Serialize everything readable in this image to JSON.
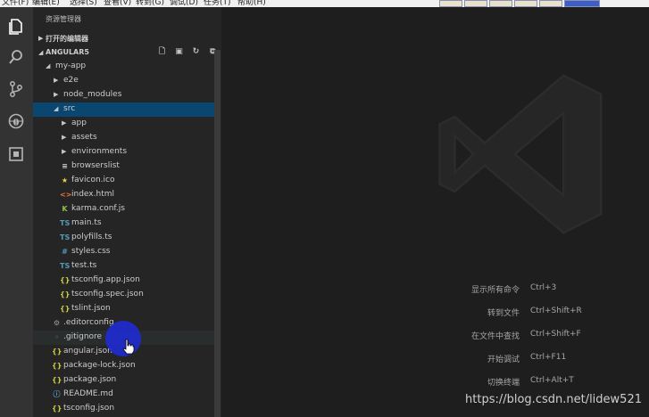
{
  "menu": {
    "items": [
      "文件(F)",
      "编辑(E)",
      "选择(S)",
      "查看(V)",
      "转到(G)",
      "调试(D)",
      "任务(T)",
      "帮助(H)"
    ]
  },
  "activity": {
    "icons": [
      "files-icon",
      "search-icon",
      "source-control-icon",
      "debug-icon",
      "extensions-icon"
    ]
  },
  "sidebar": {
    "title": "资源管理器",
    "open_editors": "打开的编辑器",
    "workspace": "ANGULAR5",
    "tree": [
      {
        "name": "my-app",
        "depth": 0,
        "type": "folder",
        "expanded": true
      },
      {
        "name": "e2e",
        "depth": 1,
        "type": "folder",
        "expanded": false
      },
      {
        "name": "node_modules",
        "depth": 1,
        "type": "folder",
        "expanded": false
      },
      {
        "name": "src",
        "depth": 1,
        "type": "folder",
        "expanded": true,
        "selected": true
      },
      {
        "name": "app",
        "depth": 2,
        "type": "folder",
        "expanded": false
      },
      {
        "name": "assets",
        "depth": 2,
        "type": "folder",
        "expanded": false
      },
      {
        "name": "environments",
        "depth": 2,
        "type": "folder",
        "expanded": false
      },
      {
        "name": "browserslist",
        "depth": 2,
        "type": "file",
        "icon": "lines"
      },
      {
        "name": "favicon.ico",
        "depth": 2,
        "type": "file",
        "icon": "star"
      },
      {
        "name": "index.html",
        "depth": 2,
        "type": "file",
        "icon": "html"
      },
      {
        "name": "karma.conf.js",
        "depth": 2,
        "type": "file",
        "icon": "karma"
      },
      {
        "name": "main.ts",
        "depth": 2,
        "type": "file",
        "icon": "ts"
      },
      {
        "name": "polyfills.ts",
        "depth": 2,
        "type": "file",
        "icon": "ts"
      },
      {
        "name": "styles.css",
        "depth": 2,
        "type": "file",
        "icon": "css"
      },
      {
        "name": "test.ts",
        "depth": 2,
        "type": "file",
        "icon": "ts"
      },
      {
        "name": "tsconfig.app.json",
        "depth": 2,
        "type": "file",
        "icon": "json"
      },
      {
        "name": "tsconfig.spec.json",
        "depth": 2,
        "type": "file",
        "icon": "json"
      },
      {
        "name": "tslint.json",
        "depth": 2,
        "type": "file",
        "icon": "json"
      },
      {
        "name": ".editorconfig",
        "depth": 1,
        "type": "file",
        "icon": "gear"
      },
      {
        "name": ".gitignore",
        "depth": 1,
        "type": "file",
        "icon": "dot",
        "hover": true
      },
      {
        "name": "angular.json",
        "depth": 1,
        "type": "file",
        "icon": "json"
      },
      {
        "name": "package-lock.json",
        "depth": 1,
        "type": "file",
        "icon": "json"
      },
      {
        "name": "package.json",
        "depth": 1,
        "type": "file",
        "icon": "json"
      },
      {
        "name": "README.md",
        "depth": 1,
        "type": "file",
        "icon": "info"
      },
      {
        "name": "tsconfig.json",
        "depth": 1,
        "type": "file",
        "icon": "json"
      }
    ]
  },
  "editor": {
    "shortcuts": [
      {
        "label": "显示所有命令",
        "keys": "Ctrl+3"
      },
      {
        "label": "转到文件",
        "keys": "Ctrl+Shift+R"
      },
      {
        "label": "在文件中查找",
        "keys": "Ctrl+Shift+F"
      },
      {
        "label": "开始调试",
        "keys": "Ctrl+F11"
      },
      {
        "label": "切换终端",
        "keys": "Ctrl+Alt+T"
      }
    ],
    "watermark_url": "https://blog.csdn.net/lidew521"
  },
  "colors": {
    "selection": "#094771",
    "sidebar_bg": "#252526",
    "editor_bg": "#1e1e1e",
    "activity_bg": "#333333",
    "cursor_highlight": "#1f2bd1"
  }
}
